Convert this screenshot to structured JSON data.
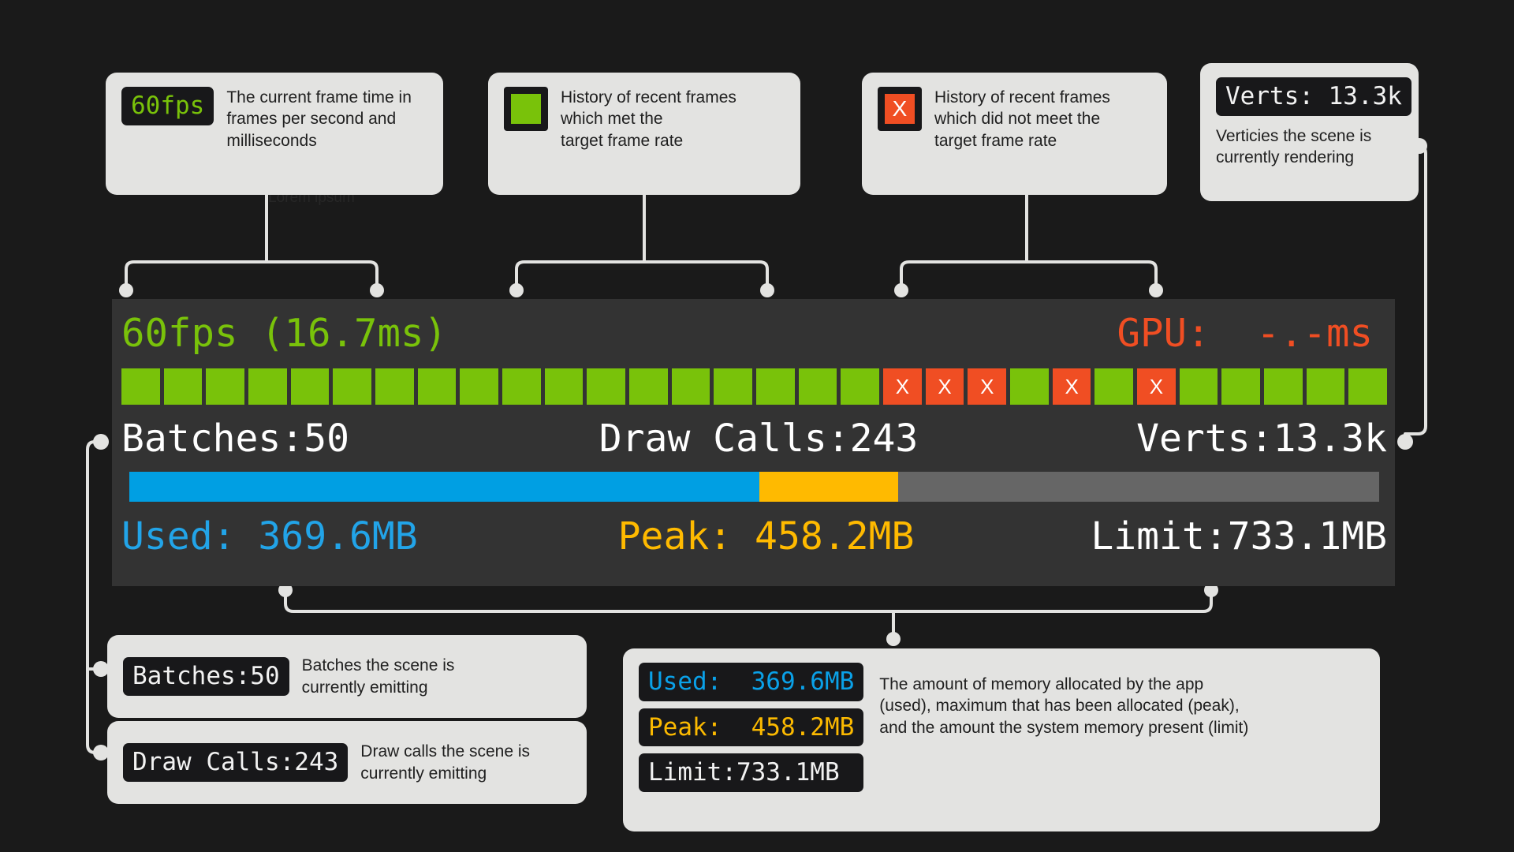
{
  "watermark": "Lorem ipsum",
  "callouts": {
    "fps": {
      "chip": "60fps",
      "text": "The current frame time in\nframes per second and\nmilliseconds"
    },
    "frame_ok": {
      "icon": "green-square",
      "text": "History of recent frames\nwhich met the\ntarget frame rate"
    },
    "frame_miss": {
      "icon": "red-x-square",
      "glyph": "X",
      "text": "History of recent frames\nwhich did not meet the\ntarget frame rate"
    },
    "verts": {
      "chip": "Verts: 13.3k",
      "text": "Verticies the scene is\ncurrently rendering"
    },
    "batches": {
      "chip": "Batches:50",
      "text": "Batches the scene is\ncurrently emitting"
    },
    "draw_calls": {
      "chip": "Draw Calls:243",
      "text": "Draw calls the scene is\ncurrently emitting"
    },
    "memory": {
      "chips": [
        {
          "label": "Used:  369.6MB",
          "color": "blue"
        },
        {
          "label": "Peak:  458.2MB",
          "color": "amber"
        },
        {
          "label": "Limit:733.1MB",
          "color": "white"
        }
      ],
      "text": "The amount of memory allocated by the app\n(used), maximum that has been allocated (peak),\nand the amount the system memory present (limit)"
    }
  },
  "hud": {
    "fps_text": "60fps (16.7ms)",
    "gpu_text": "GPU:  -.-ms",
    "batches": "Batches:50",
    "draw_calls": "Draw Calls:243",
    "verts": "Verts:13.3k",
    "used": "Used: 369.6MB",
    "peak": "Peak: 458.2MB",
    "limit": "Limit:733.1MB",
    "frame_history": [
      "ok",
      "ok",
      "ok",
      "ok",
      "ok",
      "ok",
      "ok",
      "ok",
      "ok",
      "ok",
      "ok",
      "ok",
      "ok",
      "ok",
      "ok",
      "ok",
      "ok",
      "ok",
      "miss",
      "miss",
      "miss",
      "ok",
      "miss",
      "ok",
      "miss",
      "ok",
      "ok",
      "ok",
      "ok",
      "ok"
    ],
    "frame_miss_glyph": "X",
    "memory_segments": [
      {
        "name": "used",
        "percent": 50.4
      },
      {
        "name": "peak",
        "percent": 11.1
      },
      {
        "name": "free",
        "percent": 38.5
      }
    ]
  },
  "colors": {
    "background": "#1a1a1a",
    "panel": "#333333",
    "card": "#e3e3e1",
    "chip_bg": "#18181a",
    "green": "#79c20a",
    "red": "#f04e23",
    "blue": "#009fe3",
    "amber": "#ffba00",
    "gray": "#666666",
    "connector": "#e3e3e1"
  }
}
